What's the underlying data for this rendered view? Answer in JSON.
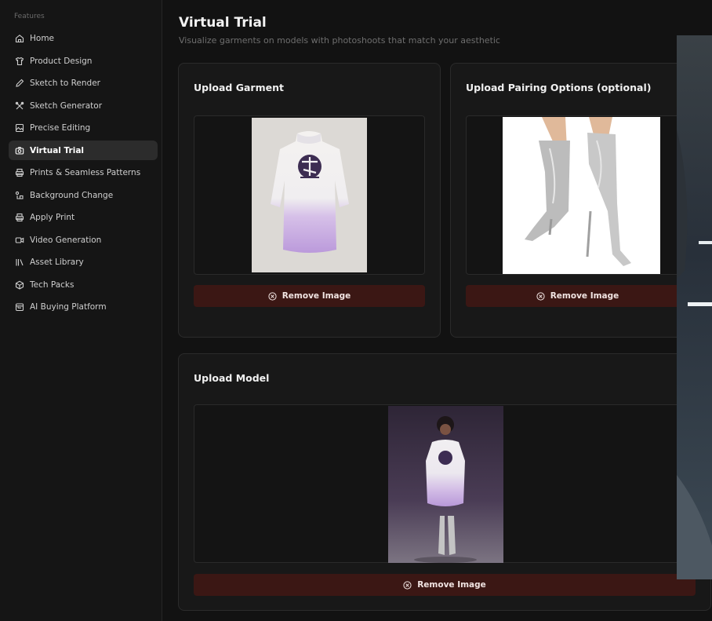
{
  "sidebar": {
    "section_label": "Features",
    "items": [
      {
        "label": "Home",
        "icon": "home-icon"
      },
      {
        "label": "Product Design",
        "icon": "shirt-icon"
      },
      {
        "label": "Sketch to Render",
        "icon": "pencil-icon"
      },
      {
        "label": "Sketch Generator",
        "icon": "tools-icon"
      },
      {
        "label": "Precise Editing",
        "icon": "image-edit-icon"
      },
      {
        "label": "Virtual Trial",
        "icon": "camera-icon",
        "active": true
      },
      {
        "label": "Prints & Seamless Patterns",
        "icon": "printer-icon"
      },
      {
        "label": "Background Change",
        "icon": "shapes-icon"
      },
      {
        "label": "Apply Print",
        "icon": "printer-icon"
      },
      {
        "label": "Video Generation",
        "icon": "video-icon"
      },
      {
        "label": "Asset Library",
        "icon": "library-icon"
      },
      {
        "label": "Tech Packs",
        "icon": "package-icon"
      },
      {
        "label": "AI Buying Platform",
        "icon": "calendar-icon"
      }
    ]
  },
  "page": {
    "title": "Virtual Trial",
    "subtitle": "Visualize garments on models with photoshoots that match your aesthetic"
  },
  "cards": {
    "garment": {
      "title": "Upload Garment",
      "remove_label": "Remove Image"
    },
    "pairing": {
      "title": "Upload Pairing Options (optional)",
      "remove_label": "Remove Image"
    },
    "model": {
      "title": "Upload Model",
      "remove_label": "Remove Image"
    }
  },
  "colors": {
    "background": "#121212",
    "sidebar_bg": "#151515",
    "active_item": "#2c2c2c",
    "remove_button": "#3b1714",
    "garment_lilac": "#c5a8e0"
  }
}
